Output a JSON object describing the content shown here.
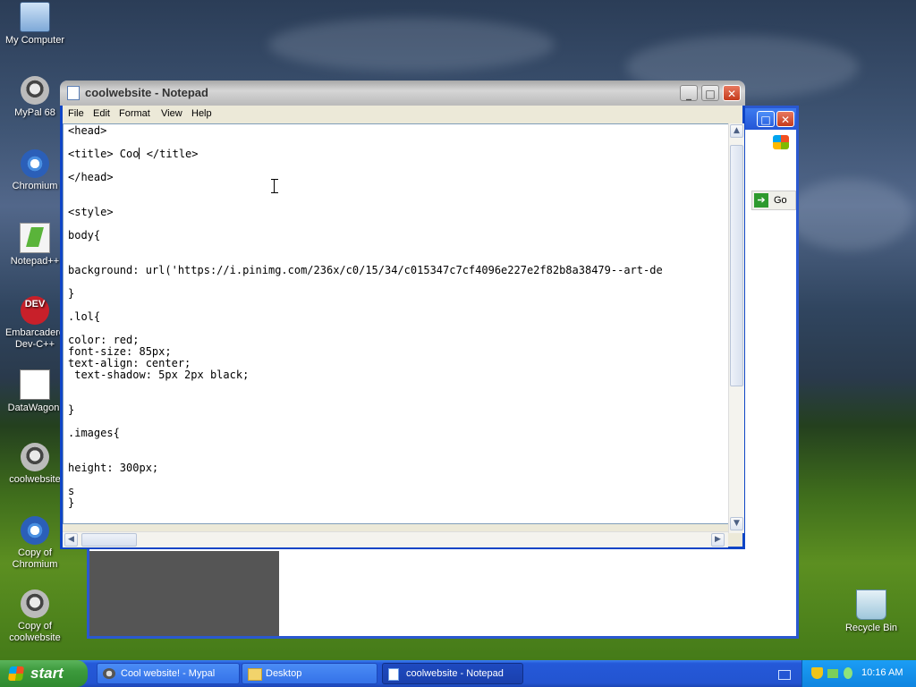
{
  "desktop": {
    "icons": [
      {
        "label": "My Computer"
      },
      {
        "label": "MyPal 68"
      },
      {
        "label": "Chromium"
      },
      {
        "label": "Notepad++"
      },
      {
        "label": "Embarcadero Dev-C++",
        "badge": "DEV"
      },
      {
        "label": "DataWagon."
      },
      {
        "label": "coolwebsite"
      },
      {
        "label": "Copy of Chromium"
      },
      {
        "label": "Copy of coolwebsite"
      },
      {
        "label": "Recycle Bin"
      }
    ]
  },
  "background_window": {
    "go_button": "Go"
  },
  "notepad": {
    "title": "coolwebsite - Notepad",
    "controls": {
      "minimize": "_",
      "maximize": "□",
      "close": "✕"
    },
    "menu": [
      "File",
      "Edit",
      "Format",
      "View",
      "Help"
    ],
    "lines": [
      "<head>",
      "<title> Coo",
      " </title>",
      "</head>",
      "<style>",
      "body{",
      "background: url('https://i.pinimg.com/236x/c0/15/34/c015347c7cf4096e227e2f82b8a38479--art-de",
      "}",
      ".lol{",
      "color: red;",
      "font-size: 85px;",
      "text-align: center;",
      " text-shadow: 5px 2px black;",
      "}",
      ".images{",
      "height: 300px;",
      "s",
      "}"
    ]
  },
  "taskbar": {
    "start_label": "start",
    "tasks": [
      {
        "label": "Cool website! - Mypal"
      },
      {
        "label": "Desktop"
      },
      {
        "label": "coolwebsite - Notepad"
      }
    ],
    "clock": "10:16 AM"
  },
  "colors": {
    "xp_blue": "#2456d6",
    "start_green": "#3c9a3c",
    "tray_blue": "#0f85e0"
  }
}
